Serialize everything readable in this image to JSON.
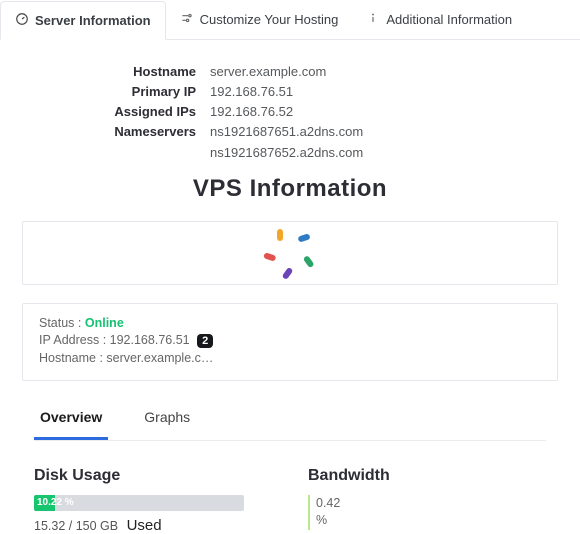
{
  "tabs": [
    {
      "label": "Server Information",
      "active": true
    },
    {
      "label": "Customize Your Hosting",
      "active": false
    },
    {
      "label": "Additional Information",
      "active": false
    }
  ],
  "server_info": {
    "hostname_label": "Hostname",
    "hostname": "server.example.com",
    "primary_ip_label": "Primary IP",
    "primary_ip": "192.168.76.51",
    "assigned_ips_label": "Assigned IPs",
    "assigned_ips": "192.168.76.52",
    "nameservers_label": "Nameservers",
    "nameservers": [
      "ns1921687651.a2dns.com",
      "ns1921687652.a2dns.com"
    ]
  },
  "vps_title": "VPS Information",
  "status_panel": {
    "status_label": "Status :",
    "status_value": "Online",
    "ip_label": "IP Address :",
    "ip_value": "192.168.76.51",
    "ip_badge": "2",
    "hostname_label": "Hostname :",
    "hostname_value": "server.example.c…"
  },
  "subtabs": {
    "overview": "Overview",
    "graphs": "Graphs"
  },
  "usage": {
    "disk_title": "Disk Usage",
    "disk_percent": 10.22,
    "disk_percent_text": "10.22 %",
    "disk_detail_small": "15.32 / 150 GB",
    "disk_detail_big": "Used",
    "bandwidth_title": "Bandwidth",
    "bandwidth_value": "0.42",
    "bandwidth_unit": "%"
  },
  "colors": {
    "online": "#16c172",
    "progress_fill": "#17c56e",
    "subtab_active": "#2d6cdf"
  }
}
